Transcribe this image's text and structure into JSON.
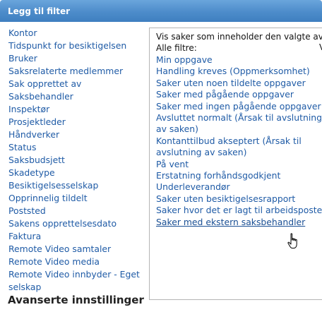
{
  "header": {
    "title": "Legg til filter"
  },
  "filters": [
    "Kontor",
    "Tidspunkt for besiktigelsen",
    "Bruker",
    "Saksrelaterte medlemmer",
    "Sak opprettet av",
    "Saksbehandler",
    "Inspektør",
    "Prosjektleder",
    "Håndverker",
    "Status",
    "Saksbudsjett",
    "Skadetype",
    "Besiktigelsesselskap",
    "Opprinnelig tildelt",
    "Poststed",
    "Sakens opprettelsesdato",
    "Faktura",
    "Remote Video samtaler",
    "Remote Video media",
    "Remote Video innbyder - Eget",
    "selskap"
  ],
  "advanced_label": "Avanserte innstillinger",
  "panel": {
    "description": "Vis saker som inneholder den valgte ava",
    "all_filters_label": "Alle filtre:",
    "right_fragment": "V",
    "options": [
      "Min oppgave",
      "Handling kreves (Oppmerksomhet)",
      "Saker uten noen tildelte oppgaver",
      "Saker med pågående oppgaver",
      "Saker med ingen pågående oppgaver",
      "Avsluttet normalt (Årsak til avslutning",
      "av saken)",
      "Kontanttilbud akseptert (Årsak til",
      "avslutning av saken)",
      "På vent",
      "Erstatning forhåndsgodkjent",
      "Underleverandør",
      "Saker uten besiktigelsesrapport",
      "Saker hvor det er lagt til arbeidsposter",
      "Saker med ekstern saksbehandler"
    ],
    "hovered_option": "Saker med ekstern saksbehandler"
  }
}
